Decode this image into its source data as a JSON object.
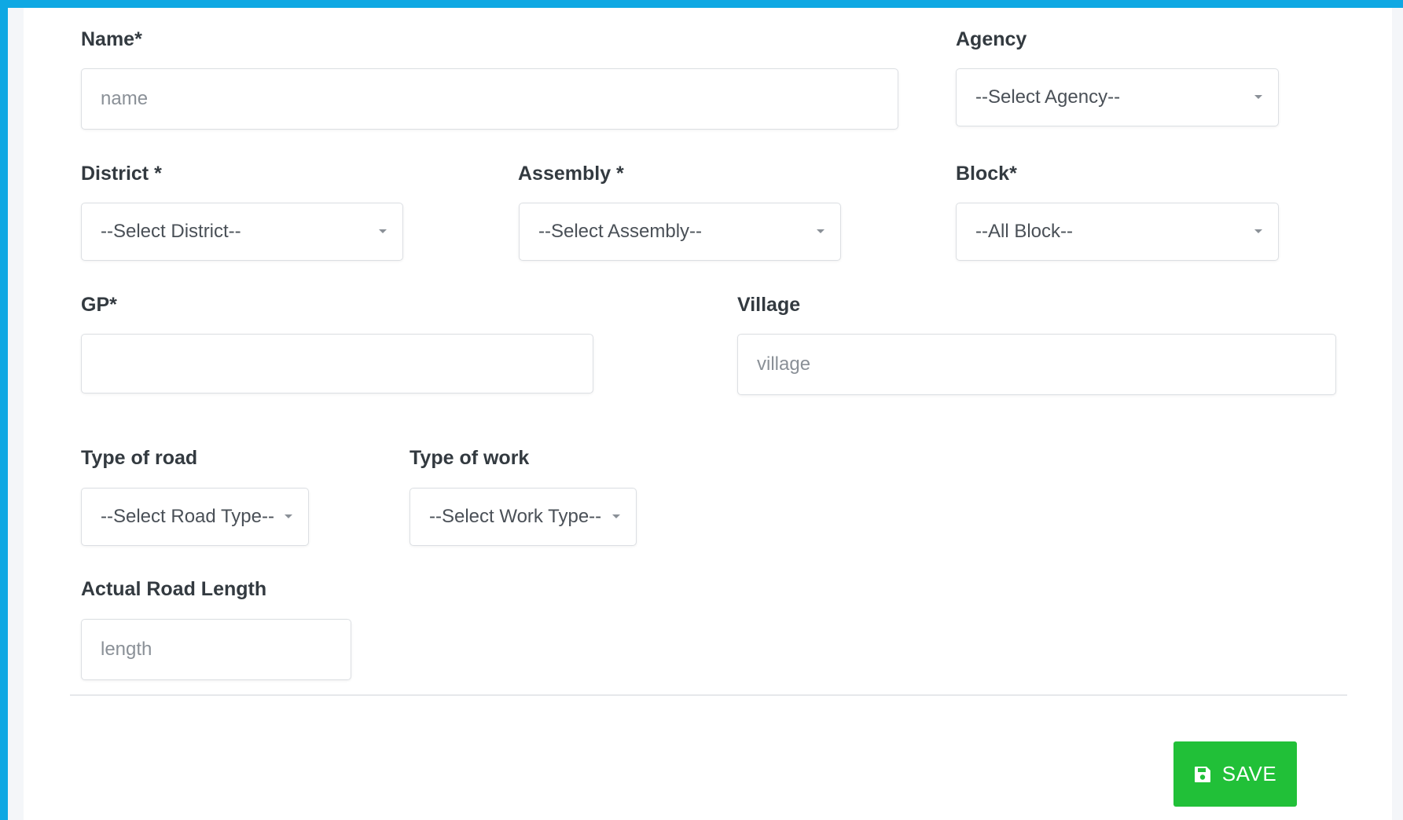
{
  "form": {
    "name": {
      "label": "Name*",
      "placeholder": "name",
      "value": ""
    },
    "agency": {
      "label": "Agency",
      "selected": "--Select Agency--"
    },
    "district": {
      "label": "District *",
      "selected": "--Select District--"
    },
    "assembly": {
      "label": "Assembly *",
      "selected": "--Select Assembly--"
    },
    "block": {
      "label": "Block*",
      "selected": "--All Block--"
    },
    "gp": {
      "label": "GP*",
      "placeholder": "",
      "value": ""
    },
    "village": {
      "label": "Village",
      "placeholder": "village",
      "value": ""
    },
    "road_type": {
      "label": "Type of road",
      "selected": "--Select Road Type--"
    },
    "work_type": {
      "label": "Type of work",
      "selected": "--Select Work Type--"
    },
    "road_length": {
      "label": "Actual Road Length",
      "placeholder": "length",
      "value": ""
    }
  },
  "actions": {
    "save_label": "SAVE",
    "save_icon": "floppy-disk-icon"
  },
  "colors": {
    "frame_accent": "#0fa8e3",
    "save_button": "#21c038"
  }
}
